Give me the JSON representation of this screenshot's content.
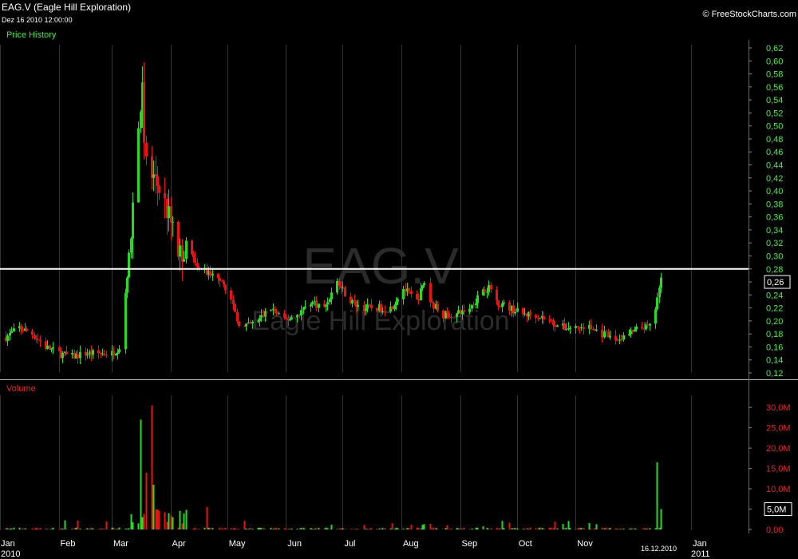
{
  "header": {
    "title": "EAG.V (Eagle Hill Exploration)",
    "datetime": "Dez 16 2010 12:00:00",
    "copyright": "© FreeStockCharts.com"
  },
  "watermark": {
    "symbol": "EAG.V",
    "name": "Eagle Hill Exploration"
  },
  "colors": {
    "up": "#22dd22",
    "down": "#ee1111",
    "grid": "#333333",
    "price_axis_text": "#44ee44",
    "volume_axis_text": "#ee2222",
    "reference_line": "#ffffff"
  },
  "chart_data": [
    {
      "type": "candlestick",
      "title": "Price History",
      "ylim": [
        0.12,
        0.62
      ],
      "y_ticks": [
        "0,12",
        "0,14",
        "0,16",
        "0,18",
        "0,20",
        "0,22",
        "0,24",
        "0,26",
        "0,28",
        "0,30",
        "0,32",
        "0,34",
        "0,36",
        "0,38",
        "0,40",
        "0,42",
        "0,44",
        "0,46",
        "0,48",
        "0,50",
        "0,52",
        "0,54",
        "0,56",
        "0,58",
        "0,60",
        "0,62"
      ],
      "last_price_label": "0,26",
      "reference_line": 0.28,
      "series_points": [
        [
          "2010-01-04",
          0.175
        ],
        [
          "2010-01-11",
          0.19
        ],
        [
          "2010-01-18",
          0.18
        ],
        [
          "2010-01-25",
          0.16
        ],
        [
          "2010-02-01",
          0.15
        ],
        [
          "2010-02-08",
          0.145
        ],
        [
          "2010-02-15",
          0.15
        ],
        [
          "2010-02-22",
          0.15
        ],
        [
          "2010-03-01",
          0.15
        ],
        [
          "2010-03-05",
          0.16
        ],
        [
          "2010-03-10",
          0.3
        ],
        [
          "2010-03-12",
          0.38
        ],
        [
          "2010-03-15",
          0.5
        ],
        [
          "2010-03-17",
          0.55
        ],
        [
          "2010-03-18",
          0.46
        ],
        [
          "2010-03-22",
          0.42
        ],
        [
          "2010-03-25",
          0.41
        ],
        [
          "2010-03-29",
          0.38
        ],
        [
          "2010-04-01",
          0.35
        ],
        [
          "2010-04-05",
          0.3
        ],
        [
          "2010-04-08",
          0.31
        ],
        [
          "2010-04-12",
          0.3
        ],
        [
          "2010-04-15",
          0.28
        ],
        [
          "2010-04-19",
          0.28
        ],
        [
          "2010-04-22",
          0.27
        ],
        [
          "2010-04-26",
          0.27
        ],
        [
          "2010-04-29",
          0.26
        ],
        [
          "2010-05-03",
          0.23
        ],
        [
          "2010-05-06",
          0.2
        ],
        [
          "2010-05-10",
          0.19
        ],
        [
          "2010-05-17",
          0.2
        ],
        [
          "2010-05-24",
          0.22
        ],
        [
          "2010-05-31",
          0.2
        ],
        [
          "2010-06-07",
          0.21
        ],
        [
          "2010-06-14",
          0.23
        ],
        [
          "2010-06-21",
          0.22
        ],
        [
          "2010-06-28",
          0.26
        ],
        [
          "2010-07-05",
          0.23
        ],
        [
          "2010-07-12",
          0.22
        ],
        [
          "2010-07-19",
          0.22
        ],
        [
          "2010-07-26",
          0.22
        ],
        [
          "2010-08-02",
          0.25
        ],
        [
          "2010-08-09",
          0.23
        ],
        [
          "2010-08-13",
          0.26
        ],
        [
          "2010-08-16",
          0.23
        ],
        [
          "2010-08-23",
          0.21
        ],
        [
          "2010-08-30",
          0.21
        ],
        [
          "2010-09-06",
          0.22
        ],
        [
          "2010-09-13",
          0.25
        ],
        [
          "2010-09-17",
          0.25
        ],
        [
          "2010-09-20",
          0.23
        ],
        [
          "2010-09-27",
          0.22
        ],
        [
          "2010-10-04",
          0.21
        ],
        [
          "2010-10-11",
          0.21
        ],
        [
          "2010-10-18",
          0.2
        ],
        [
          "2010-10-25",
          0.19
        ],
        [
          "2010-11-01",
          0.19
        ],
        [
          "2010-11-08",
          0.19
        ],
        [
          "2010-11-15",
          0.18
        ],
        [
          "2010-11-22",
          0.17
        ],
        [
          "2010-11-29",
          0.18
        ],
        [
          "2010-12-06",
          0.19
        ],
        [
          "2010-12-10",
          0.19
        ],
        [
          "2010-12-13",
          0.22
        ],
        [
          "2010-12-15",
          0.25
        ],
        [
          "2010-12-16",
          0.27
        ]
      ]
    },
    {
      "type": "bar",
      "title": "Volume",
      "ylim": [
        0,
        32000000
      ],
      "y_ticks": [
        "0,00",
        "5,0M",
        "10,0M",
        "15,0M",
        "20,0M",
        "25,0M",
        "30,0M"
      ],
      "last_volume_label": "5,0M",
      "spikes": [
        [
          "2010-03-16",
          27000000
        ],
        [
          "2010-03-22",
          30500000
        ],
        [
          "2010-03-19",
          14000000
        ],
        [
          "2010-03-23",
          11000000
        ],
        [
          "2010-04-20",
          5500000
        ],
        [
          "2010-12-14",
          16500000
        ],
        [
          "2010-12-16",
          5000000
        ]
      ]
    }
  ],
  "x_axis": {
    "months": [
      {
        "label": "Jan",
        "date": "2010-01-01"
      },
      {
        "label": "Feb",
        "date": "2010-02-01"
      },
      {
        "label": "Mar",
        "date": "2010-03-01"
      },
      {
        "label": "Apr",
        "date": "2010-04-01"
      },
      {
        "label": "May",
        "date": "2010-05-01"
      },
      {
        "label": "Jun",
        "date": "2010-06-01"
      },
      {
        "label": "Jul",
        "date": "2010-07-01"
      },
      {
        "label": "Aug",
        "date": "2010-08-01"
      },
      {
        "label": "Sep",
        "date": "2010-09-01"
      },
      {
        "label": "Oct",
        "date": "2010-10-01"
      },
      {
        "label": "Nov",
        "date": "2010-11-01"
      },
      {
        "label": "Jan",
        "date": "2011-01-01"
      }
    ],
    "year_start": "2010",
    "year_end": "2011",
    "cursor_date": "16.12.2010"
  }
}
